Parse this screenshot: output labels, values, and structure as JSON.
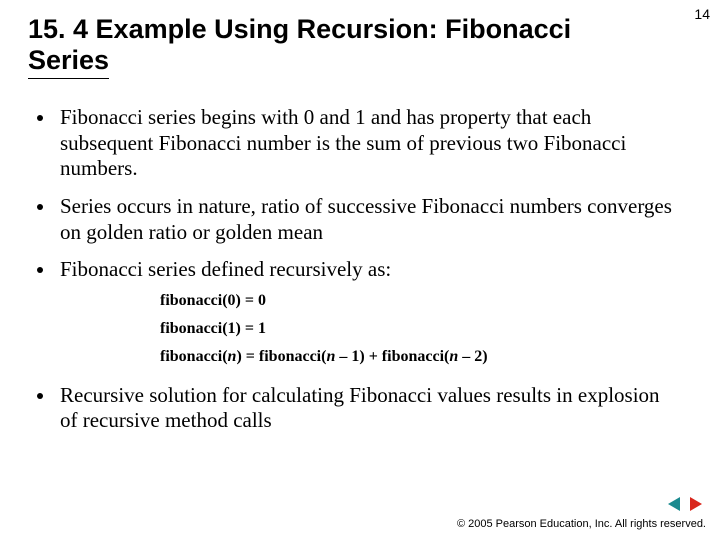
{
  "page_number": "14",
  "title_line1": "15. 4 Example Using Recursion: Fibonacci",
  "title_line2": "Series",
  "bullets": {
    "b1": "Fibonacci series begins with 0 and 1 and has property that each subsequent Fibonacci number is the sum of previous two Fibonacci numbers.",
    "b2": "Series occurs in nature, ratio of successive Fibonacci numbers converges on golden ratio or golden mean",
    "b3": "Fibonacci series defined recursively as:",
    "b4": "Recursive solution for calculating Fibonacci values results in explosion of recursive method calls"
  },
  "defs": {
    "d1_pre": "fibonacci(0) = 0",
    "d2_pre": "fibonacci(1) = 1",
    "d3_a": "fibonacci(",
    "d3_n1": "n",
    "d3_b": ") = fibonacci(",
    "d3_n2": "n",
    "d3_c": " – 1) + fibonacci(",
    "d3_n3": "n",
    "d3_d": " – 2)"
  },
  "footer": "© 2005 Pearson Education, Inc.  All rights reserved.",
  "nav_colors": {
    "prev": "#1a8a8f",
    "next": "#d9261c"
  }
}
